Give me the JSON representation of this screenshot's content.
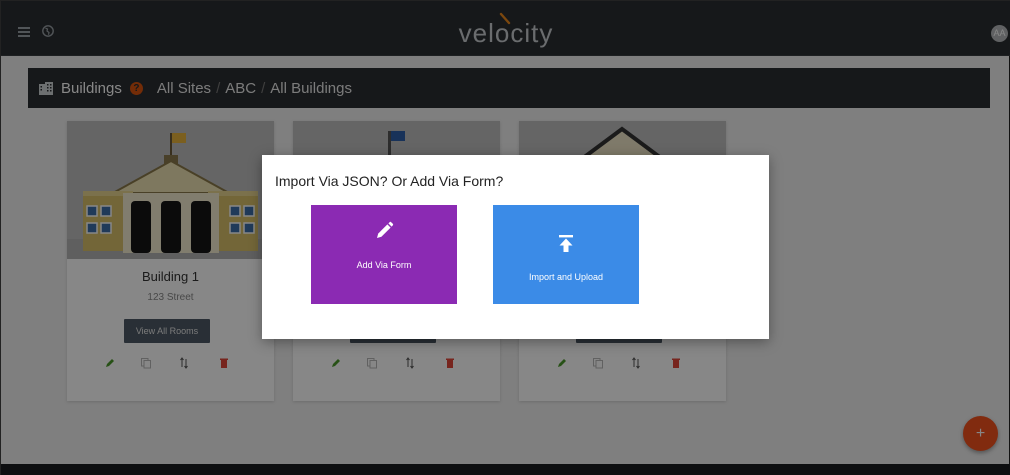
{
  "app": {
    "logo_text": "velocity",
    "avatar_initials": "AA"
  },
  "topbar": {
    "menu_icon": "hamburger-menu-icon",
    "globe_icon": "globe-icon"
  },
  "breadcrumb": {
    "title": "Buildings",
    "help": "?",
    "items": [
      "All Sites",
      "ABC",
      "All Buildings"
    ],
    "separator": "/"
  },
  "cards": [
    {
      "name": "Building 1",
      "address": "123 Street",
      "rooms_button": "View All Rooms"
    },
    {
      "name": "",
      "address": "",
      "rooms_button": ""
    },
    {
      "name": "",
      "address": "",
      "rooms_button": ""
    }
  ],
  "card_actions": [
    "edit-icon",
    "copy-icon",
    "sort-icon",
    "delete-icon"
  ],
  "modal": {
    "heading": "Import Via JSON? Or Add Via Form?",
    "add_form_label": "Add Via Form",
    "import_label": "Import and Upload"
  },
  "fab": {
    "label": "+"
  },
  "colors": {
    "topbar": "#2b2e31",
    "form_option": "#8b2ab3",
    "upload_option": "#3b8be7",
    "fab": "#f4511e",
    "help_badge": "#d9530f"
  }
}
